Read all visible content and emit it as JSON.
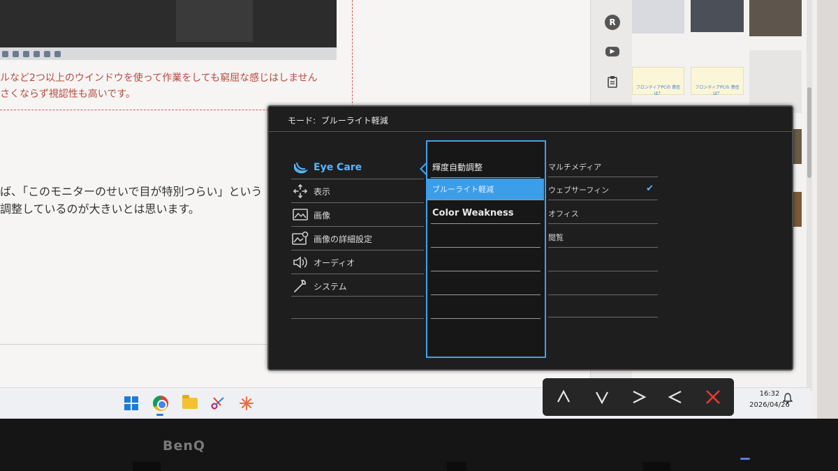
{
  "article": {
    "red_line_1": "ルなど2つ以上のウインドウを使って作業をしても窮屈な感じはしません",
    "red_line_2": "さくならず視認性も高いです。",
    "body_line_1": "ば、「このモニターのせいで目が特別つらい」という",
    "body_line_2": "調整しているのが大きいとは思います。"
  },
  "thumbnails": {
    "cartoon_1": "フロンティアPCの\n責任は？",
    "cartoon_2": "フロンティアPCの\n責任は？"
  },
  "osd": {
    "mode_label": "モード:",
    "mode_value": "ブルーライト軽減",
    "menu": [
      {
        "label": "Eye Care",
        "icon": "eye-care-icon",
        "selected": true
      },
      {
        "label": "表示",
        "icon": "display-icon",
        "selected": false
      },
      {
        "label": "画像",
        "icon": "picture-icon",
        "selected": false
      },
      {
        "label": "画像の詳細設定",
        "icon": "picture-advanced-icon",
        "selected": false
      },
      {
        "label": "オーディオ",
        "icon": "speaker-icon",
        "selected": false
      },
      {
        "label": "システム",
        "icon": "wrench-icon",
        "selected": false
      }
    ],
    "submenu": [
      {
        "label": "輝度自動調整",
        "state": "normal"
      },
      {
        "label": "ブルーライト軽減",
        "state": "highlighted"
      },
      {
        "label": "Color Weakness",
        "state": "normal"
      }
    ],
    "options": [
      {
        "label": "マルチメディア",
        "checked": false
      },
      {
        "label": "ウェブサーフィン",
        "checked": true
      },
      {
        "label": "オフィス",
        "checked": false
      },
      {
        "label": "閲覧",
        "checked": false
      }
    ],
    "accent_color": "#3da3f2"
  },
  "keys": [
    {
      "name": "up-key",
      "icon": "chevron-up-icon"
    },
    {
      "name": "down-key",
      "icon": "chevron-down-icon"
    },
    {
      "name": "right-key",
      "icon": "chevron-right-icon"
    },
    {
      "name": "left-key",
      "icon": "chevron-left-icon"
    },
    {
      "name": "exit-key",
      "icon": "close-icon",
      "color": "#e53935"
    }
  ],
  "taskbar": {
    "time": "16:32",
    "date": "2026/04/26"
  },
  "brand": "BenQ"
}
